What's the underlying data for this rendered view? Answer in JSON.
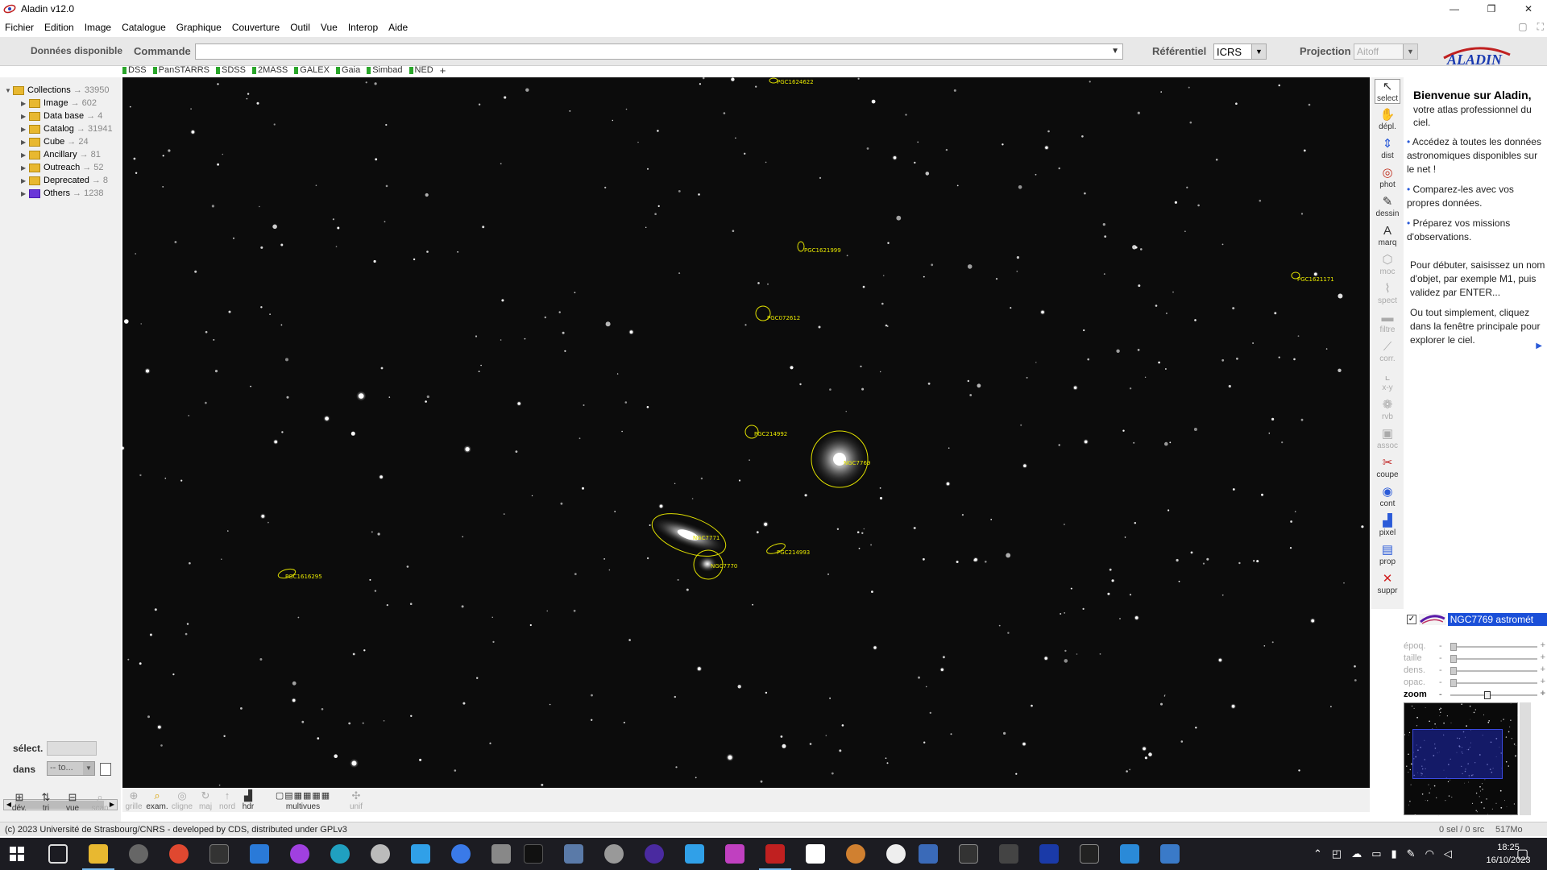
{
  "window": {
    "title": "Aladin v12.0",
    "controls": [
      "—",
      "❐",
      "✕"
    ]
  },
  "menu": [
    "Fichier",
    "Edition",
    "Image",
    "Catalogue",
    "Graphique",
    "Couverture",
    "Outil",
    "Vue",
    "Interop",
    "Aide"
  ],
  "cmdbar": {
    "donnees_label": "Données disponible",
    "commande_label": "Commande",
    "commande_value": "",
    "referentiel_label": "Référentiel",
    "referentiel_value": "ICRS",
    "projection_label": "Projection",
    "projection_value": "Aitoff",
    "logo_text": "ALADIN"
  },
  "surveys": [
    "DSS",
    "PanSTARRS",
    "SDSS",
    "2MASS",
    "GALEX",
    "Gaia",
    "Simbad",
    "NED"
  ],
  "surveys_plus": "+",
  "tree": {
    "root": {
      "label": "Collections",
      "count": "→ 33950"
    },
    "items": [
      {
        "label": "Image",
        "count": "→ 602",
        "color": "#e8b830"
      },
      {
        "label": "Data base",
        "count": "→ 4",
        "color": "#e8b830"
      },
      {
        "label": "Catalog",
        "count": "→ 31941",
        "color": "#e8b830"
      },
      {
        "label": "Cube",
        "count": "→ 24",
        "color": "#e8b830"
      },
      {
        "label": "Ancillary",
        "count": "→ 81",
        "color": "#e8b830"
      },
      {
        "label": "Outreach",
        "count": "→ 52",
        "color": "#e8b830"
      },
      {
        "label": "Deprecated",
        "count": "→ 8",
        "color": "#e8b830"
      },
      {
        "label": "Others",
        "count": "→ 1238",
        "color": "#6a35d8"
      }
    ]
  },
  "left_controls": {
    "select_label": "sélect.",
    "dans_label": "dans",
    "dans_value": "-- to..."
  },
  "left_bottom_tools": [
    "dév.",
    "tri",
    "vue",
    "scan"
  ],
  "bottom_tools": [
    "grille",
    "exam.",
    "cligne",
    "maj",
    "nord",
    "hdr",
    "multivues",
    "unif"
  ],
  "right_tools": [
    "select",
    "dépl.",
    "dist",
    "phot",
    "dessin",
    "marq",
    "moc",
    "spect",
    "filtre",
    "corr.",
    "x-y",
    "rvb",
    "assoc",
    "coupe",
    "cont",
    "pixel",
    "prop",
    "suppr"
  ],
  "welcome": {
    "title": "Bienvenue sur Aladin,",
    "subtitle": "votre atlas professionnel du ciel.",
    "bullets": [
      "Accédez à toutes les données astronomiques disponibles sur le net !",
      "Comparez-les avec vos propres données.",
      "Préparez vos missions d'observations."
    ],
    "para1": "Pour débuter, saisissez un nom d'objet, par exemple M1, puis validez par ENTER...",
    "para2": "Ou tout simplement, cliquez dans la fenêtre principale pour explorer le ciel."
  },
  "layer": {
    "name": "NGC7769 astromét",
    "checked": "✓"
  },
  "sliders": [
    {
      "label": "époq.",
      "value": 0
    },
    {
      "label": "taille",
      "value": 0
    },
    {
      "label": "dens.",
      "value": 0
    },
    {
      "label": "opac.",
      "value": 0
    },
    {
      "label": "zoom",
      "value": 0.42
    }
  ],
  "objects": [
    {
      "label": "PGC1624622"
    },
    {
      "label": "PGC1621999"
    },
    {
      "label": "PGC072612"
    },
    {
      "label": "PGC1621171"
    },
    {
      "label": "PGC214992"
    },
    {
      "label": "NGC7769"
    },
    {
      "label": "NGC7771"
    },
    {
      "label": "NGC7770"
    },
    {
      "label": "PGC214993"
    },
    {
      "label": "PGC1616295"
    }
  ],
  "status": {
    "copyright": "(c) 2023 Université de Strasbourg/CNRS - developed by CDS, distributed under GPLv3",
    "selection": "0 sel / 0 src",
    "memory": "517Mo"
  },
  "clock": {
    "time": "18:25",
    "date": "16/10/2023"
  }
}
